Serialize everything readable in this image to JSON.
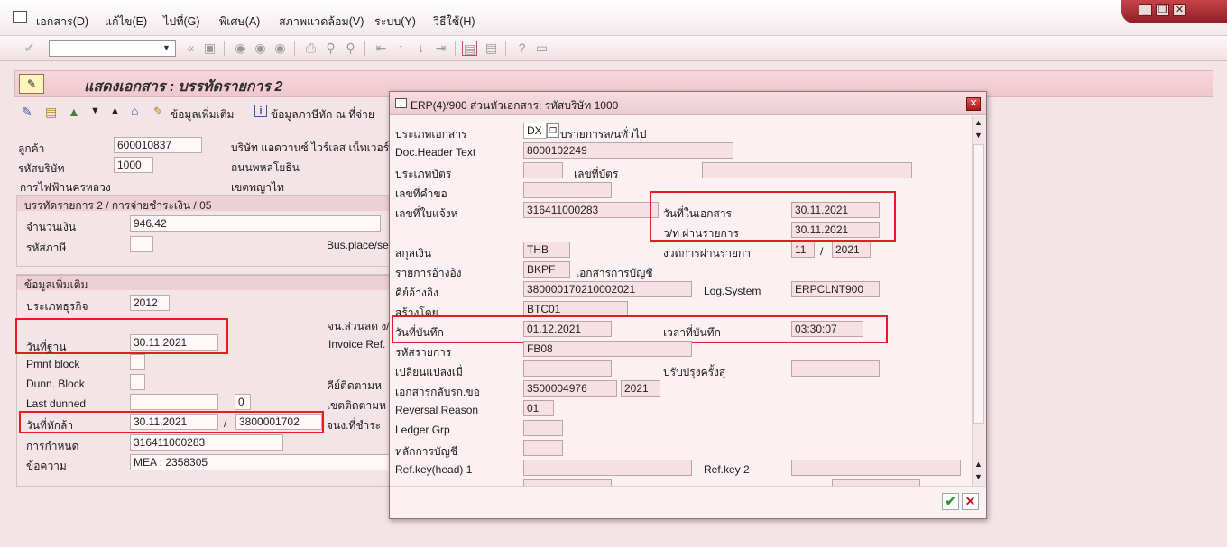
{
  "menu": [
    "เอกสาร(D)",
    "แก้ไข(E)",
    "ไปที่(G)",
    "พิเศษ(A)",
    "สภาพแวดล้อม(V)",
    "ระบบ(Y)",
    "วิธีใช้(H)"
  ],
  "window": {
    "min": "_",
    "restore": "❐",
    "close": "✕"
  },
  "title": "แสดงเอกสาร : บรรทัดรายการ 2",
  "apptoolbar": {
    "more_data": "ข้อมูลเพิ่มเติม",
    "withholding": "ข้อมูลภาษีหัก ณ ที่จ่าย"
  },
  "main": {
    "customer_label": "ลูกค้า",
    "customer": "600010837",
    "company_label": "รหัสบริษัท",
    "company": "1000",
    "company_name": "บริษัท แอดวานซ์ ไวร์เลส เน็ทเวอร์ค",
    "road": "ถนนพหลโยธิน",
    "org": "การไฟฟ้านครหลวง",
    "district": "เขตพญาไท",
    "item_group": "บรรทัดรายการ 2 / การจ่ายชำระเงิน / 05",
    "amount_label": "จำนวนเงิน",
    "amount": "946.42",
    "taxcode_label": "รหัสภาษี",
    "busplace": "Bus.place/se",
    "more_group": "ข้อมูลเพิ่มเติม",
    "bustype_label": "ประเภทธุรกิจ",
    "bustype": "2012",
    "disc_label": "จน.ส่วนลด ง/",
    "basedate_label": "วันที่ฐาน",
    "basedate": "30.11.2021",
    "invref_label": "Invoice Ref.",
    "pmnt_label": "Pmnt block",
    "dunn_label": "Dunn. Block",
    "lastdun_label": "Last dunned",
    "lastdun_lvl": "0",
    "dunkey_label": "คีย์ติดตามห",
    "dunarea_label": "เขตติดตามห",
    "clrdate_label": "วันที่หักล้า",
    "clrdate": "30.11.2021",
    "clr_sep": "/",
    "clrdoc": "3800001702",
    "paycount_label": "จนง.ที่ชำระ",
    "assign_label": "การกำหนด",
    "assign": "316411000283",
    "text_label": "ข้อความ",
    "text": "MEA : 2358305"
  },
  "dialog": {
    "title": "ERP(4)/900 ส่วนหัวเอกสาร: รหัสบริษัท 1000",
    "doctype_label": "ประเภทเอกสาร",
    "doctype": "DX",
    "doctype_desc": "บรายการล/นทั่วไป",
    "hdrtext_label": "Doc.Header Text",
    "hdrtext": "8000102249",
    "cardtype_label": "ประเภทบัตร",
    "cardno_label": "เลขที่บัตร",
    "reqno_label": "เลขที่คำขอ",
    "invno_label": "เลขที่ใบแจ้งห",
    "invno": "316411000283",
    "docdate_label": "วันที่ในเอกสาร",
    "docdate": "30.11.2021",
    "postdate_label": "ว/ท ผ่านรายการ",
    "postdate": "30.11.2021",
    "currency_label": "สกุลเงิน",
    "currency": "THB",
    "period_label": "งวดการผ่านรายกา",
    "period": "11",
    "period_sep": "/",
    "year": "2021",
    "ref_label": "รายการอ้างอิง",
    "ref": "BKPF",
    "ref_desc": "เอกสารการบัญชี",
    "refkey_label": "คีย์อ้างอิง",
    "refkey": "380000170210002021",
    "logsys_label": "Log.System",
    "logsys": "ERPCLNT900",
    "createdby_label": "สร้างโดย",
    "createdby": "BTC01",
    "entrydate_label": "วันที่บันทึก",
    "entrydate": "01.12.2021",
    "entrytime_label": "เวลาที่บันทึก",
    "entrytime": "03:30:07",
    "tcode_label": "รหัสรายการ",
    "tcode": "FB08",
    "changed_label": "เปลี่ยนแปลงเมื่",
    "lastupd_label": "ปรับปรุงครั้งสุ",
    "revdoc_label": "เอกสารกลับรก.ขอ",
    "revdoc": "3500004976",
    "revyear": "2021",
    "revreason_label": "Reversal Reason",
    "revreason": "01",
    "ledger_label": "Ledger Grp",
    "principle_label": "หลักการบัญชี",
    "refkey1_label": "Ref.key(head) 1",
    "refkey2_label": "Ref.key 2"
  }
}
